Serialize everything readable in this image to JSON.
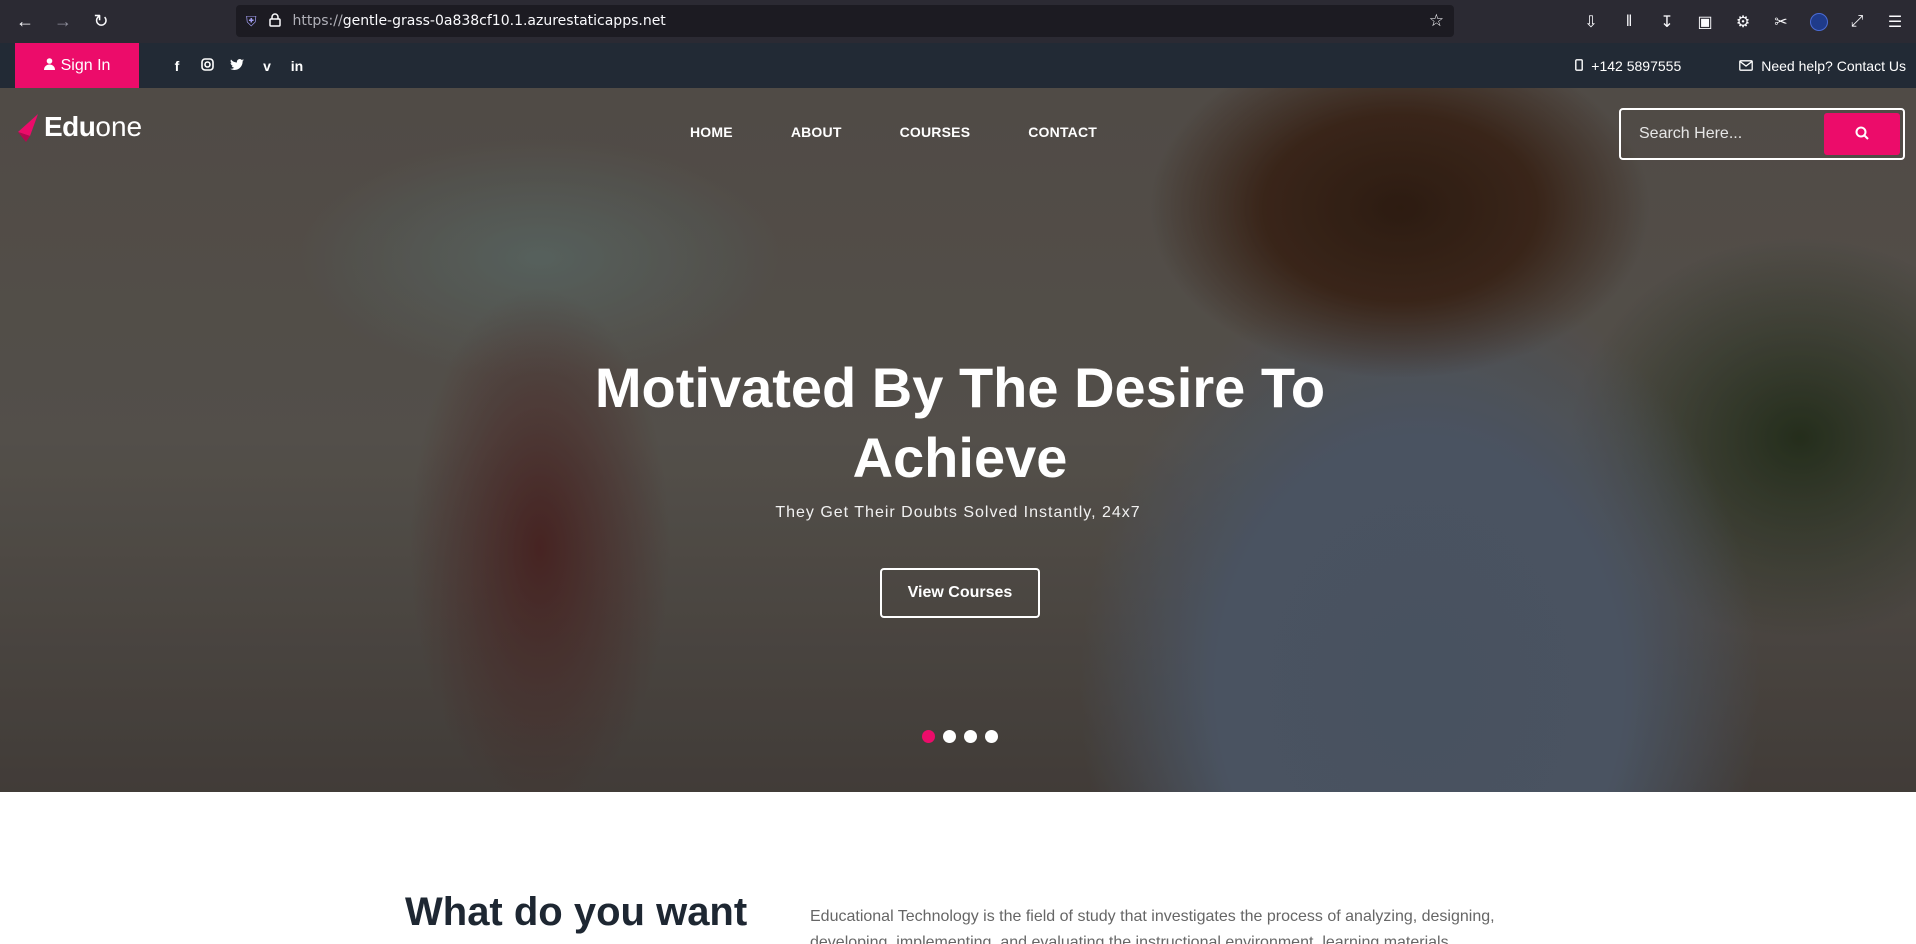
{
  "browser": {
    "url_protocol": "https://",
    "url_host": "gentle-grass-0a838cf10.1.azurestaticapps.net"
  },
  "topbar": {
    "signin_label": "Sign In",
    "phone": "+142 5897555",
    "help": "Need help? Contact Us"
  },
  "logo": {
    "part1": "Edu",
    "part2": "one"
  },
  "nav": {
    "items": [
      "HOME",
      "ABOUT",
      "COURSES",
      "CONTACT"
    ]
  },
  "search": {
    "placeholder": "Search Here..."
  },
  "hero": {
    "title": "Motivated By The Desire To Achieve",
    "subtitle": "They Get Their Doubts Solved Instantly, 24x7",
    "button": "View Courses",
    "slides": 4,
    "active_slide": 1
  },
  "section": {
    "title": "What do you want",
    "text": "Educational Technology is the field of study that investigates the process of analyzing, designing, developing, implementing, and evaluating the instructional environment, learning materials, learners"
  },
  "colors": {
    "accent": "#ec0c6a",
    "topbar": "#222a35",
    "chrome": "#2b2a33"
  }
}
